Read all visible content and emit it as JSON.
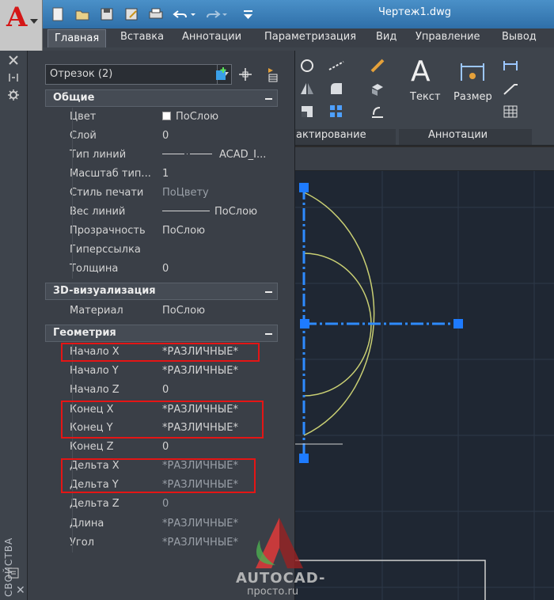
{
  "app": {
    "document_title": "Чертеж1.dwg",
    "icon": "autocad-a-icon"
  },
  "quick_access": [
    {
      "name": "new-icon"
    },
    {
      "name": "open-icon"
    },
    {
      "name": "save-icon"
    },
    {
      "name": "saveas-icon"
    },
    {
      "name": "print-icon"
    },
    {
      "name": "undo-icon"
    },
    {
      "name": "redo-icon"
    },
    {
      "name": "customize-dropdown-icon"
    }
  ],
  "ribbon": {
    "tabs": [
      {
        "label": "Главная",
        "active": true
      },
      {
        "label": "Вставка"
      },
      {
        "label": "Аннотации"
      },
      {
        "label": "Параметризация"
      },
      {
        "label": "Вид"
      },
      {
        "label": "Управление"
      },
      {
        "label": "Вывод"
      }
    ],
    "panels": {
      "modify_label_partial": "актирование",
      "annotation_label": "Аннотации",
      "text_label": "Текст",
      "dimension_label": "Размер"
    }
  },
  "palette": {
    "side_title": "СВОЙСТВА",
    "selection": "Отрезок (2)",
    "sections": {
      "general": {
        "title": "Общие",
        "rows": [
          {
            "name": "Цвет",
            "value": "ПоСлою"
          },
          {
            "name": "Слой",
            "value": "0"
          },
          {
            "name": "Тип линий",
            "value": "ACAD_I..."
          },
          {
            "name": "Масштаб тип...",
            "value": "1"
          },
          {
            "name": "Стиль печати",
            "value": "ПоЦвету"
          },
          {
            "name": "Вес линий",
            "value": "ПоСлою"
          },
          {
            "name": "Прозрачность",
            "value": "ПоСлою"
          },
          {
            "name": "Гиперссылка",
            "value": ""
          },
          {
            "name": "Толщина",
            "value": "0"
          }
        ]
      },
      "viz3d": {
        "title": "3D-визуализация",
        "rows": [
          {
            "name": "Материал",
            "value": "ПоСлою"
          }
        ]
      },
      "geometry": {
        "title": "Геометрия",
        "rows": [
          {
            "name": "Начало X",
            "value": "*РАЗЛИЧНЫЕ*"
          },
          {
            "name": "Начало Y",
            "value": "*РАЗЛИЧНЫЕ*"
          },
          {
            "name": "Начало Z",
            "value": "0"
          },
          {
            "name": "Конец X",
            "value": "*РАЗЛИЧНЫЕ*"
          },
          {
            "name": "Конец Y",
            "value": "*РАЗЛИЧНЫЕ*"
          },
          {
            "name": "Конец Z",
            "value": "0"
          },
          {
            "name": "Дельта X",
            "value": "*РАЗЛИЧНЫЕ*"
          },
          {
            "name": "Дельта Y",
            "value": "*РАЗЛИЧНЫЕ*"
          },
          {
            "name": "Дельта Z",
            "value": "0"
          },
          {
            "name": "Длина",
            "value": "*РАЗЛИЧНЫЕ*"
          },
          {
            "name": "Угол",
            "value": "*РАЗЛИЧНЫЕ*"
          }
        ]
      }
    }
  },
  "watermark": {
    "text": "AUTOCAD-",
    "sub": "просто.ru"
  },
  "colors": {
    "highlight_box": "#e41515",
    "grip": "#1e7bff",
    "arc": "#c9cf73"
  }
}
